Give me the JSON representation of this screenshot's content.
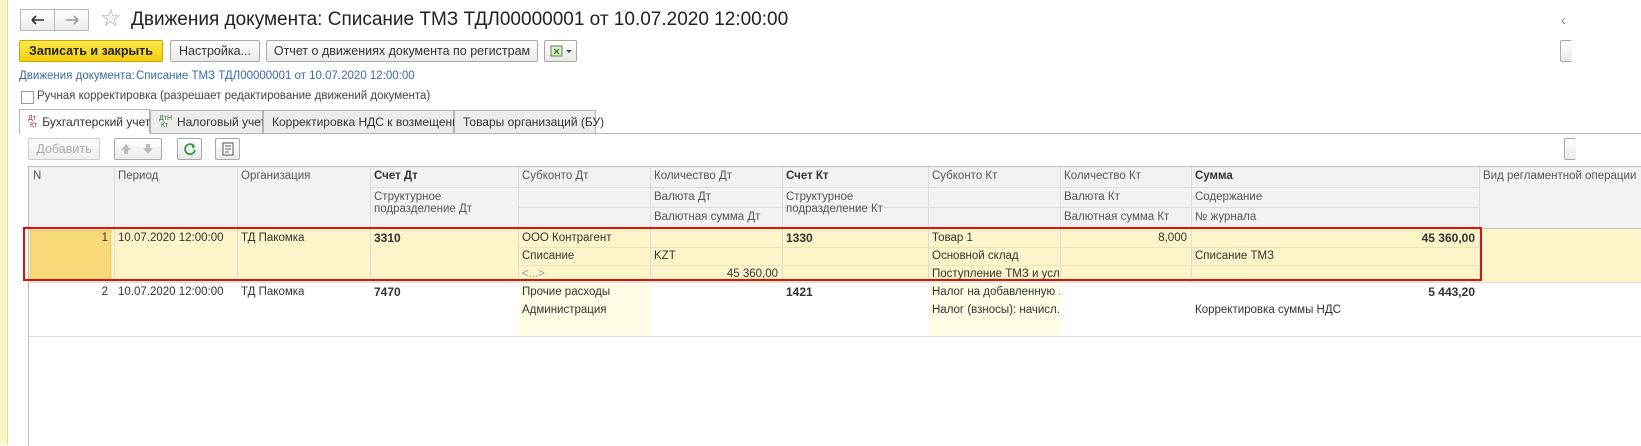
{
  "window": {
    "title": "Движения документа: Списание ТМЗ ТДЛ00000001 от 10.07.2020 12:00:00",
    "star": "☆"
  },
  "toolbar": {
    "save_close": "Записать и закрыть",
    "settings": "Настройка...",
    "report": "Отчет о движениях документа по регистрам"
  },
  "breadcrumb": {
    "label": "Движения документа:",
    "link": "Списание ТМЗ ТДЛ00000001 от 10.07.2020 12:00:00"
  },
  "manual_edit": {
    "checked": false,
    "label": "Ручная корректировка (разрешает редактирование движений документа)"
  },
  "tabs": [
    {
      "label": "Бухгалтерский учет",
      "icon": "Дт\nКт"
    },
    {
      "label": "Налоговый учет",
      "icon": "Дт\nКт"
    },
    {
      "label": "Корректировка НДС к возмещению"
    },
    {
      "label": "Товары организаций (БУ)"
    }
  ],
  "table_toolbar": {
    "add": "Добавить"
  },
  "headers": {
    "n": "N",
    "period": "Период",
    "org": "Организация",
    "account_dt": "Счет Дт",
    "subdiv_dt": "Структурное подразделение Дт",
    "subconto_dt": "Субконто Дт",
    "qty_dt": "Количество Дт",
    "cur_dt": "Валюта Дт",
    "cur_sum_dt": "Валютная сумма Дт",
    "account_kt": "Счет Кт",
    "subdiv_kt": "Структурное подразделение Кт",
    "subconto_kt": "Субконто Кт",
    "qty_kt": "Количество Кт",
    "cur_kt": "Валюта Кт",
    "cur_sum_kt": "Валютная сумма Кт",
    "sum": "Сумма",
    "content": "Содержание",
    "journal": "№ журнала",
    "reg_op": "Вид регламентной операции"
  },
  "rows": [
    {
      "n": "1",
      "period": "10.07.2020 12:00:00",
      "org": "ТД Пакомка",
      "account_dt": "3310",
      "subconto_dt": [
        "ООО Контрагент",
        "Списание",
        "<...>"
      ],
      "cur_dt": "KZT",
      "cur_sum_dt": "45 360,00",
      "account_kt": "1330",
      "subconto_kt": [
        "Товар 1",
        "Основной склад",
        "Поступление ТМЗ и усл..."
      ],
      "qty_kt": "8,000",
      "sum": "45 360,00",
      "content": "Списание ТМЗ"
    },
    {
      "n": "2",
      "period": "10.07.2020 12:00:00",
      "org": "ТД Пакомка",
      "account_dt": "7470",
      "subconto_dt": [
        "Прочие расходы",
        "Администрация"
      ],
      "account_kt": "1421",
      "subconto_kt": [
        "Налог на добавленную ...",
        "Налог (взносы): начисл..."
      ],
      "sum": "5 443,20",
      "content": "Корректировка суммы НДС"
    }
  ],
  "colors": {
    "primary_button": "#f5d31a",
    "selection_frame": "#e01010",
    "row_highlight": "#fdf4c9",
    "link": "#3a6aa8"
  }
}
